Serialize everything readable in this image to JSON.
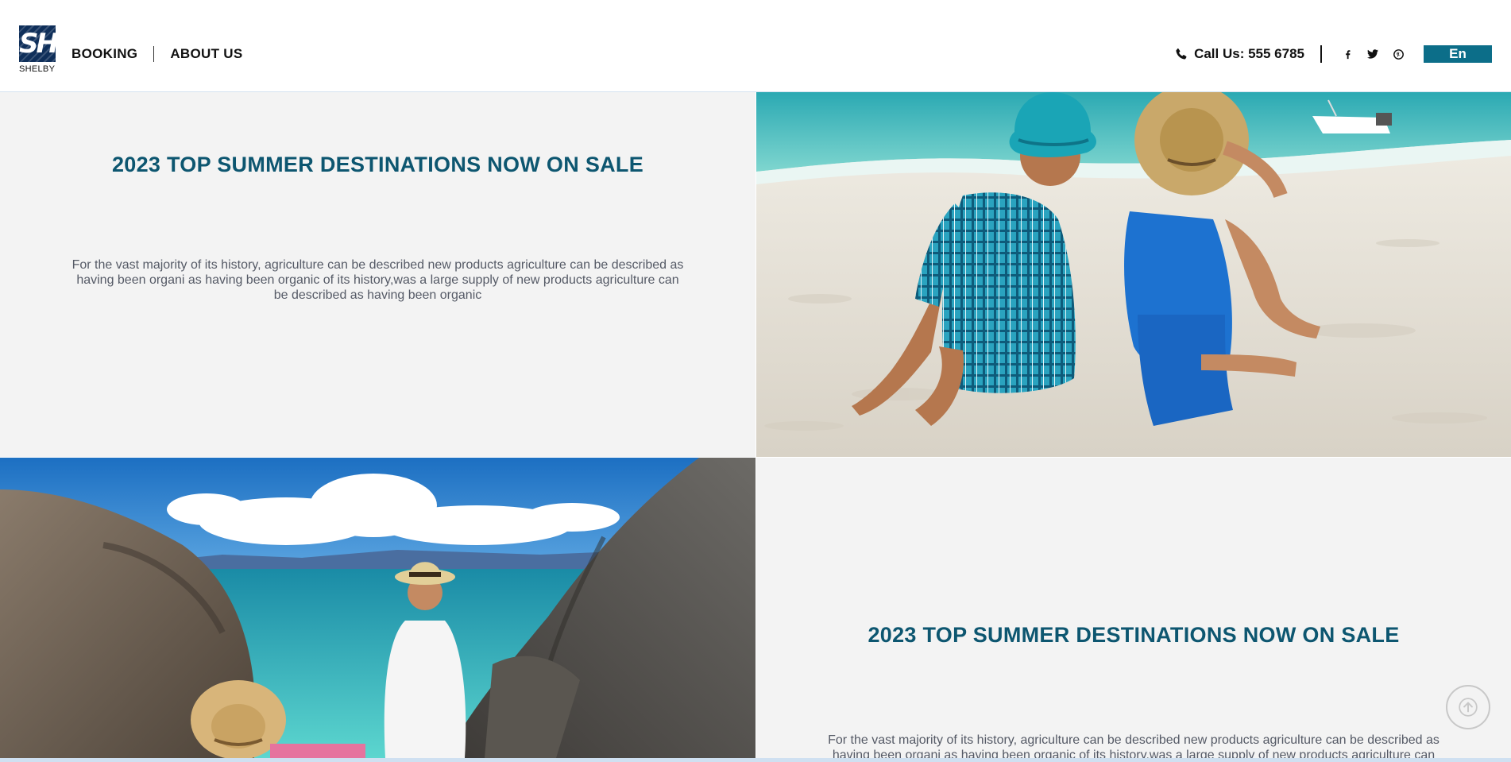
{
  "brand": {
    "logo_mark": "SH",
    "name": "SHELBY"
  },
  "nav": {
    "items": [
      {
        "label": "BOOKING"
      },
      {
        "label": "ABOUT US"
      }
    ]
  },
  "contact": {
    "call_label": "Call Us: 555 6785",
    "icon": "phone-icon"
  },
  "social": [
    {
      "icon": "facebook-icon"
    },
    {
      "icon": "twitter-icon"
    },
    {
      "icon": "pinterest-icon"
    }
  ],
  "language": {
    "label": "En"
  },
  "colors": {
    "accent": "#0c6e89",
    "headline": "#0d5670",
    "panel": "#f3f3f3"
  },
  "sections": [
    {
      "title": "2023 TOP SUMMER DESTINATIONS NOW ON SALE",
      "text": "For the vast majority of its history, agriculture can be described new products agriculture can be described as having been organi as having been organic of its history,was a large supply of new products agriculture can be described as having been organic",
      "image": "beach-couple-photo"
    },
    {
      "title": "2023 TOP SUMMER DESTINATIONS NOW ON SALE",
      "text": "For the vast majority of its history, agriculture can be described new products agriculture can be described as having been organi as having been organic of its history,was a large supply of new products agriculture can be described as having been organic",
      "image": "rocks-sea-photo"
    }
  ]
}
